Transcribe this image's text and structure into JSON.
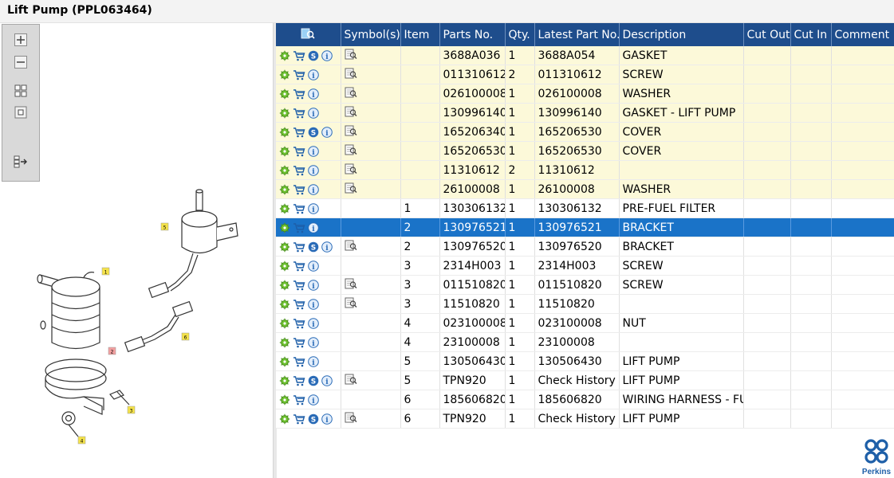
{
  "window": {
    "title": "Lift Pump (PPL063464)"
  },
  "toolbar": {
    "zoom_in": "zoom-in",
    "zoom_out": "zoom-out",
    "fit": "fit-view",
    "actual": "actual-size",
    "export": "export"
  },
  "diagram": {
    "callouts": [
      "1",
      "2",
      "3",
      "4",
      "5",
      "6"
    ]
  },
  "table": {
    "columns": [
      "",
      "Symbol(s)",
      "Item",
      "Parts No.",
      "Qty.",
      "Latest Part No.",
      "Description",
      "Cut Out",
      "Cut In",
      "Comment"
    ],
    "rows": [
      {
        "style": "yellow",
        "s": true,
        "sym": true,
        "item": "",
        "part": "3688A036",
        "qty": "1",
        "latest": "3688A054",
        "desc": "GASKET"
      },
      {
        "style": "yellow",
        "s": false,
        "sym": true,
        "item": "",
        "part": "011310612",
        "qty": "2",
        "latest": "011310612",
        "desc": "SCREW"
      },
      {
        "style": "yellow",
        "s": false,
        "sym": true,
        "item": "",
        "part": "026100008",
        "qty": "1",
        "latest": "026100008",
        "desc": "WASHER"
      },
      {
        "style": "yellow",
        "s": false,
        "sym": true,
        "item": "",
        "part": "130996140",
        "qty": "1",
        "latest": "130996140",
        "desc": "GASKET - LIFT PUMP"
      },
      {
        "style": "yellow",
        "s": true,
        "sym": true,
        "item": "",
        "part": "165206340",
        "qty": "1",
        "latest": "165206530",
        "desc": "COVER"
      },
      {
        "style": "yellow",
        "s": false,
        "sym": true,
        "item": "",
        "part": "165206530",
        "qty": "1",
        "latest": "165206530",
        "desc": "COVER"
      },
      {
        "style": "yellow",
        "s": false,
        "sym": true,
        "item": "",
        "part": "11310612",
        "qty": "2",
        "latest": "11310612",
        "desc": ""
      },
      {
        "style": "yellow",
        "s": false,
        "sym": true,
        "item": "",
        "part": "26100008",
        "qty": "1",
        "latest": "26100008",
        "desc": "WASHER"
      },
      {
        "style": "white",
        "s": false,
        "sym": false,
        "item": "1",
        "part": "130306132",
        "qty": "1",
        "latest": "130306132",
        "desc": "PRE-FUEL FILTER"
      },
      {
        "style": "selected",
        "s": false,
        "sym": false,
        "item": "2",
        "part": "130976521",
        "qty": "1",
        "latest": "130976521",
        "desc": "BRACKET"
      },
      {
        "style": "white",
        "s": true,
        "sym": true,
        "item": "2",
        "part": "130976520",
        "qty": "1",
        "latest": "130976520",
        "desc": "BRACKET"
      },
      {
        "style": "white",
        "s": false,
        "sym": false,
        "item": "3",
        "part": "2314H003",
        "qty": "1",
        "latest": "2314H003",
        "desc": "SCREW"
      },
      {
        "style": "white",
        "s": false,
        "sym": true,
        "item": "3",
        "part": "011510820",
        "qty": "1",
        "latest": "011510820",
        "desc": "SCREW"
      },
      {
        "style": "white",
        "s": false,
        "sym": true,
        "item": "3",
        "part": "11510820",
        "qty": "1",
        "latest": "11510820",
        "desc": ""
      },
      {
        "style": "white",
        "s": false,
        "sym": false,
        "item": "4",
        "part": "023100008",
        "qty": "1",
        "latest": "023100008",
        "desc": "NUT"
      },
      {
        "style": "white",
        "s": false,
        "sym": false,
        "item": "4",
        "part": "23100008",
        "qty": "1",
        "latest": "23100008",
        "desc": ""
      },
      {
        "style": "white",
        "s": false,
        "sym": false,
        "item": "5",
        "part": "130506430",
        "qty": "1",
        "latest": "130506430",
        "desc": "LIFT PUMP"
      },
      {
        "style": "white",
        "s": true,
        "sym": true,
        "item": "5",
        "part": "TPN920",
        "qty": "1",
        "latest": "Check History",
        "desc": "LIFT PUMP"
      },
      {
        "style": "white",
        "s": false,
        "sym": false,
        "item": "6",
        "part": "185606820",
        "qty": "1",
        "latest": "185606820",
        "desc": "WIRING HARNESS - FU"
      },
      {
        "style": "white",
        "s": true,
        "sym": true,
        "item": "6",
        "part": "TPN920",
        "qty": "1",
        "latest": "Check History",
        "desc": "LIFT PUMP"
      }
    ]
  },
  "brand": {
    "name": "Perkins",
    "color": "#1e5fa8"
  },
  "colors": {
    "header": "#1e4d8c",
    "selected": "#1a73c8",
    "highlight_row": "#fcf9d9"
  }
}
